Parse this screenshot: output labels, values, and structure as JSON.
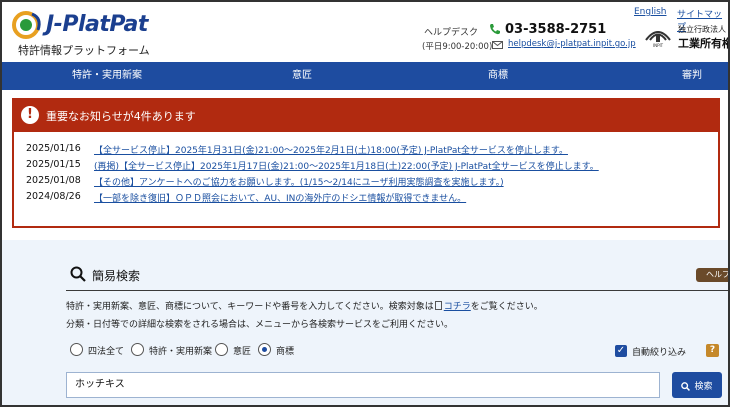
{
  "header": {
    "logo_text": "J-PlatPat",
    "logo_subtitle": "特許情報プラットフォーム",
    "helpdesk_label": "ヘルプデスク",
    "helpdesk_hours": "(平日9:00-20:00)",
    "phone": "03-3588-2751",
    "email": "helpdesk@j-platpat.inpit.go.jp",
    "link_english": "English",
    "link_sitemap": "サイトマップ",
    "inpit_small": "独立行政法人",
    "inpit_name": "工業所有権"
  },
  "nav": {
    "items": [
      "特許・実用新案",
      "意匠",
      "商標",
      "審判"
    ]
  },
  "notices": {
    "title": "重要なお知らせが4件あります",
    "items": [
      {
        "date": "2025/01/16",
        "text": "【全サービス停止】2025年1月31日(金)21:00～2025年2月1日(土)18:00(予定) J-PlatPat全サービスを停止します。"
      },
      {
        "date": "2025/01/15",
        "text": "(再掲)【全サービス停止】2025年1月17日(金)21:00～2025年1月18日(土)22:00(予定) J-PlatPat全サービスを停止します。"
      },
      {
        "date": "2025/01/08",
        "text": "【その他】アンケートへのご協力をお願いします。(1/15～2/14にユーザ利用実態調査を実施します。)"
      },
      {
        "date": "2024/08/26",
        "text": "【一部を除き復旧】ＯＰＤ照会において、AU、INの海外庁のドシエ情報が取得できません。"
      }
    ]
  },
  "search": {
    "title": "簡易検索",
    "help_label": "ヘルプ",
    "description_1_before": "特許・実用新案、意匠、商標について、キーワードや番号を入力してください。検索対象は",
    "description_1_link": "コチラ",
    "description_1_after": "をご覧ください。",
    "description_2": "分類・日付等での詳細な検索をされる場合は、メニューから各検索サービスをご利用ください。",
    "radios": [
      {
        "label": "四法全て",
        "selected": false
      },
      {
        "label": "特許・実用新案",
        "selected": false
      },
      {
        "label": "意匠",
        "selected": false
      },
      {
        "label": "商標",
        "selected": true
      }
    ],
    "auto_narrow_label": "自動絞り込み",
    "auto_narrow_checked": true,
    "help_badge": "?",
    "input_value": "ホッチキス",
    "button_label": "検索"
  },
  "colors": {
    "brand_blue": "#1e4ca0",
    "alert_red": "#b12a10",
    "search_bg": "#eef4fb"
  }
}
